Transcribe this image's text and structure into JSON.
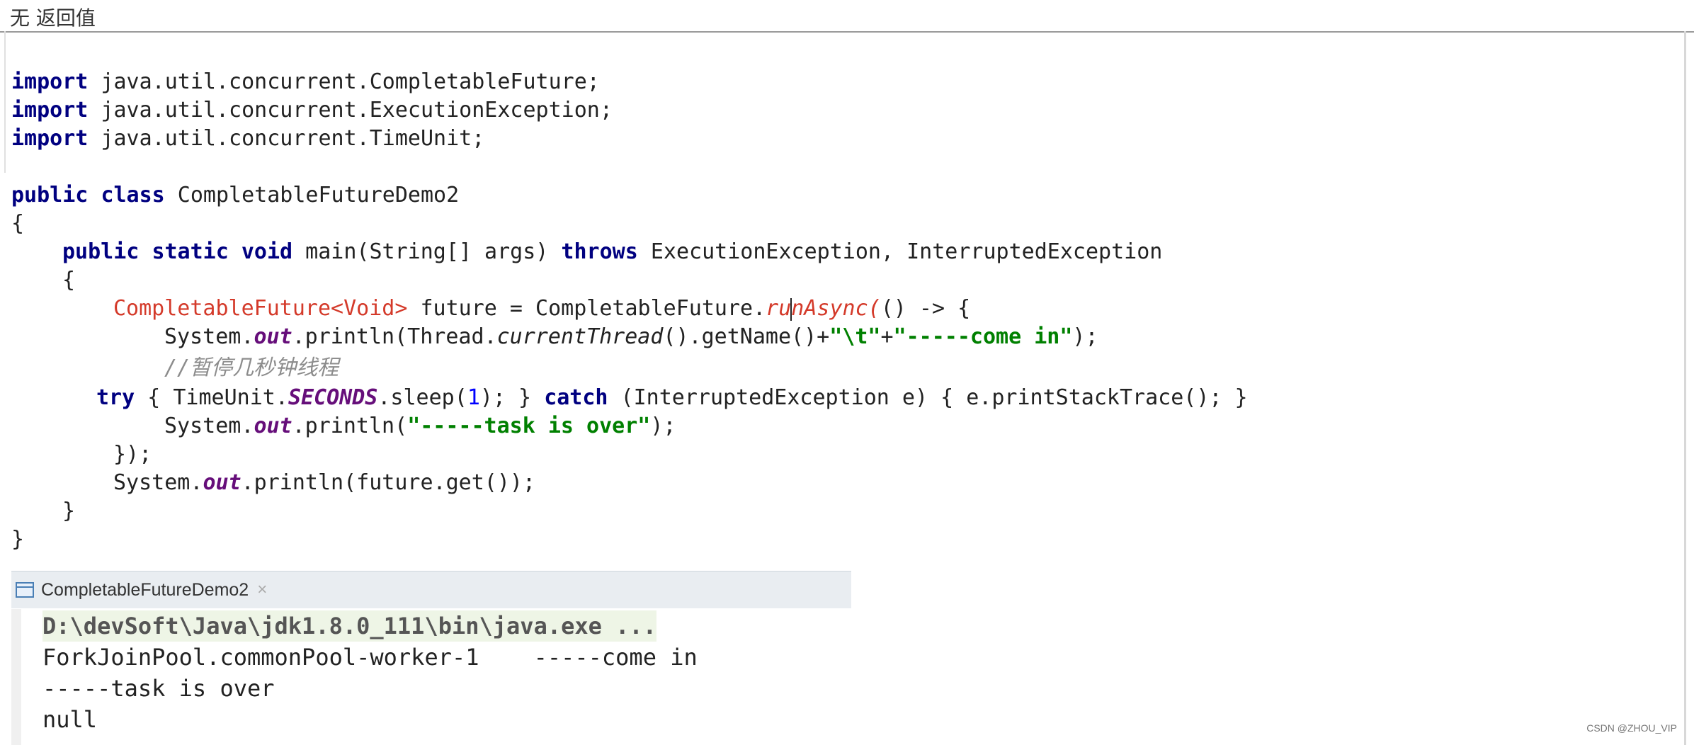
{
  "window": {
    "title": "无 返回值"
  },
  "code": {
    "imports": [
      {
        "keyword": "import",
        "rest": " java.util.concurrent.CompletableFuture;"
      },
      {
        "keyword": "import",
        "rest": " java.util.concurrent.ExecutionException;"
      },
      {
        "keyword": "import",
        "rest": " java.util.concurrent.TimeUnit;"
      }
    ],
    "class_decl": {
      "kw1": "public",
      "kw2": "class",
      "name": " CompletableFutureDemo2"
    },
    "open_brace": "{",
    "main_decl": {
      "kw1": "public",
      "kw2": "static",
      "kw3": "void",
      "sig": " main(String[] args) ",
      "throws": "throws",
      "exceptions": " ExecutionException, InterruptedException"
    },
    "method_open": "{",
    "future_line": {
      "type": "CompletableFuture<Void>",
      "mid": " future = CompletableFuture.",
      "method_a": "ru",
      "method_b": "nAsync(",
      "rest": "() -> {"
    },
    "println1": {
      "a": "System.",
      "out": "out",
      "b": ".println(Thread.",
      "current": "currentThread",
      "c": "().getName()+",
      "s1": "\"\\t\"",
      "plus": "+",
      "s2": "\"-----come in\"",
      "end": ");"
    },
    "comment": "//暂停几秒钟线程",
    "try_line": {
      "try": "try",
      "a": " { TimeUnit.",
      "seconds": "SECONDS",
      "b": ".sleep(",
      "num": "1",
      "c": "); } ",
      "catch": "catch",
      "d": " (InterruptedException e) { e.printStackTrace(); }"
    },
    "println2": {
      "a": "System.",
      "out": "out",
      "b": ".println(",
      "s": "\"-----task is over\"",
      "end": ");"
    },
    "close_lambda": "});",
    "println3": {
      "a": "System.",
      "out": "out",
      "b": ".println(future.get());"
    },
    "method_close": "}",
    "class_close": "}"
  },
  "console": {
    "tab_label": "CompletableFutureDemo2",
    "close_glyph": "×",
    "lines": [
      "D:\\devSoft\\Java\\jdk1.8.0_111\\bin\\java.exe ...",
      "ForkJoinPool.commonPool-worker-1    -----come in",
      "-----task is over",
      "null"
    ]
  },
  "watermark": "CSDN @ZHOU_VIP"
}
